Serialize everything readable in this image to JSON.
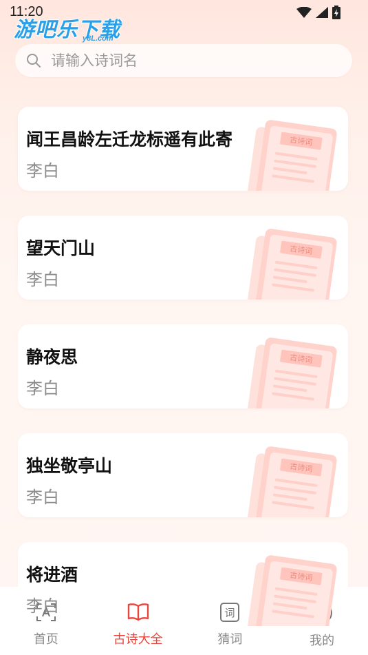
{
  "status_bar": {
    "time": "11:20"
  },
  "watermark": {
    "text": "游吧乐下载",
    "sub": "y8L.com"
  },
  "search": {
    "placeholder": "请输入诗词名",
    "value": ""
  },
  "poems": [
    {
      "title": "闻王昌龄左迁龙标遥有此寄",
      "author": "李白"
    },
    {
      "title": "望天门山",
      "author": "李白"
    },
    {
      "title": "静夜思",
      "author": "李白"
    },
    {
      "title": "独坐敬亭山",
      "author": "李白"
    },
    {
      "title": "将进酒",
      "author": "李白"
    }
  ],
  "card_badge": "古诗词",
  "tabbar": {
    "tabs": [
      {
        "label": "首页",
        "icon": "text-scan-icon"
      },
      {
        "label": "古诗大全",
        "icon": "book-open-icon",
        "active": true
      },
      {
        "label": "猜词",
        "icon": "word-box-icon"
      },
      {
        "label": "我的",
        "icon": "user-circle-icon"
      }
    ]
  },
  "colors": {
    "accent": "#e8453c",
    "watermark": "#2aa0e8"
  }
}
